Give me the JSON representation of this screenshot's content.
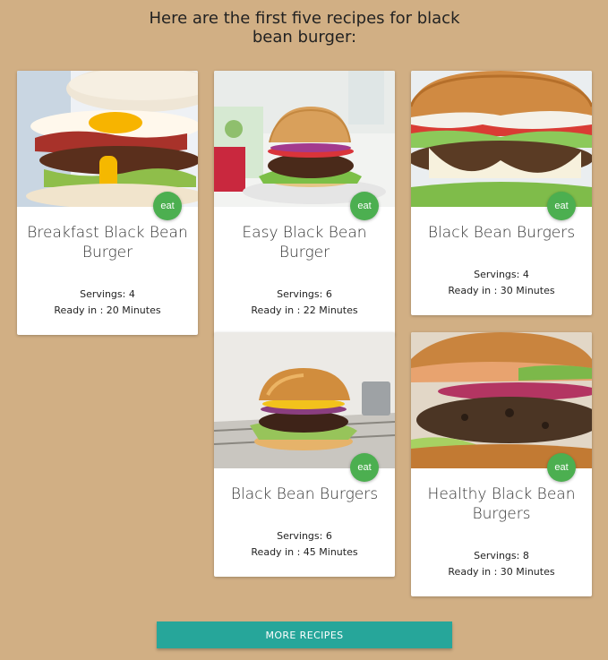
{
  "page": {
    "heading": "Here are the first five recipes for black bean burger:",
    "background_color": "#d1af84"
  },
  "recipes": [
    {
      "title": "Breakfast Black Bean Burger",
      "servings": "Servings: 4",
      "ready": "Ready in : 20 Minutes",
      "badge": "eat"
    },
    {
      "title": "Easy Black Bean Burger",
      "servings": "Servings: 6",
      "ready": "Ready in : 22 Minutes",
      "badge": "eat"
    },
    {
      "title": "Black Bean Burgers",
      "servings": "Servings: 4",
      "ready": "Ready in : 30 Minutes",
      "badge": "eat"
    },
    {
      "title": "Black Bean Burgers",
      "servings": "Servings: 6",
      "ready": "Ready in : 45 Minutes",
      "badge": "eat"
    },
    {
      "title": "Healthy Black Bean Burgers",
      "servings": "Servings: 8",
      "ready": "Ready in : 30 Minutes",
      "badge": "eat"
    }
  ],
  "actions": {
    "more_label": "MORE RECIPES"
  },
  "colors": {
    "badge": "#4caf50",
    "button": "#26a69a"
  }
}
